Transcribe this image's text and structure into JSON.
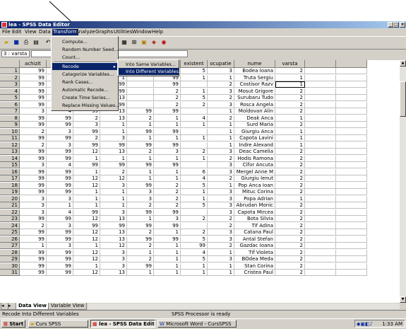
{
  "window": {
    "title": "lea - SPSS Data Editor"
  },
  "menubar": [
    "File",
    "Edit",
    "View",
    "Data",
    "Transform",
    "Analyze",
    "Graphs",
    "Utilities",
    "Window",
    "Help"
  ],
  "menubar_active": "Transform",
  "cellbar": {
    "ref": "3 : varsta"
  },
  "columns": [
    "",
    "achizit",
    "",
    "",
    "",
    "",
    "itate",
    "existent",
    "ocupatie",
    "nume",
    "varsta",
    "",
    ""
  ],
  "rows": [
    [
      "99",
      "",
      "",
      "",
      "",
      "1",
      "5",
      "3",
      "Bodea Ioana",
      "2"
    ],
    [
      "99",
      "",
      "",
      "1",
      "",
      "99",
      "1",
      "1",
      "Truta Sergiu",
      "1"
    ],
    [
      "99",
      "",
      "",
      "99",
      "",
      "99",
      "",
      "2",
      "Costisor Razv",
      "1"
    ],
    [
      "99",
      "",
      "",
      "99",
      "",
      "2",
      "1",
      "3",
      "Mosut Grigore",
      "2"
    ],
    [
      "99",
      "",
      "",
      "13",
      "",
      "2",
      "5",
      "2",
      "Surubaru Tudo",
      "2"
    ],
    [
      "99",
      "",
      "",
      "99",
      "",
      "2",
      "2",
      "3",
      "Rosca Angela",
      "2"
    ],
    [
      "3",
      "4",
      "99",
      "13",
      "99",
      "99",
      "",
      "1",
      "Moldovan Alin",
      "2"
    ],
    [
      "99",
      "99",
      "2",
      "13",
      "2",
      "1",
      "4",
      "2",
      "Deak Anca",
      "1"
    ],
    [
      "99",
      "99",
      "3",
      "1",
      "1",
      "1",
      "1",
      "1",
      "Surd Maria",
      "2"
    ],
    [
      "2",
      "3",
      "99",
      "1",
      "99",
      "99",
      "",
      "1",
      "Giurgiu Anca",
      "1"
    ],
    [
      "99",
      "99",
      "2",
      "3",
      "1",
      "1",
      "1",
      "1",
      "Capota Lavini",
      "1"
    ],
    [
      "2",
      "3",
      "99",
      "99",
      "99",
      "99",
      "",
      "1",
      "Indre Alexand",
      "1"
    ],
    [
      "99",
      "99",
      "12",
      "13",
      "2",
      "3",
      "2",
      "3",
      "Deac Camelia",
      "2"
    ],
    [
      "99",
      "99",
      "1",
      "1",
      "1",
      "1",
      "1",
      "2",
      "Hodis Ramona",
      "2"
    ],
    [
      "3",
      "4",
      "99",
      "99",
      "99",
      "99",
      "",
      "3",
      "Cifor Ancuta",
      "2"
    ],
    [
      "99",
      "99",
      "1",
      "2",
      "1",
      "1",
      "6",
      "3",
      "Mergel Anne M",
      "2"
    ],
    [
      "99",
      "99",
      "12",
      "12",
      "1",
      "1",
      "4",
      "2",
      "Giurgiu Ienut",
      "2"
    ],
    [
      "99",
      "99",
      "12",
      "3",
      "99",
      "2",
      "5",
      "1",
      "Pop Anca Ioan",
      "2"
    ],
    [
      "99",
      "99",
      "1",
      "1",
      "3",
      "2",
      "1",
      "3",
      "Mituc Corina",
      "2"
    ],
    [
      "3",
      "3",
      "1",
      "1",
      "3",
      "2",
      "1",
      "3",
      "Popa Adrian",
      "1"
    ],
    [
      "3",
      "1",
      "1",
      "1",
      "2",
      "2",
      "5",
      "3",
      "Abrudan Monic",
      "2"
    ],
    [
      "3",
      "4",
      "99",
      "3",
      "99",
      "99",
      "",
      "3",
      "Capota Mircea",
      "2"
    ],
    [
      "99",
      "99",
      "12",
      "13",
      "1",
      "3",
      "2",
      "2",
      "Bota Silvia",
      "2"
    ],
    [
      "2",
      "3",
      "99",
      "99",
      "99",
      "99",
      "",
      "2",
      "Tif Adina",
      "2"
    ],
    [
      "99",
      "99",
      "12",
      "13",
      "2",
      "1",
      "2",
      "3",
      "Catana Paul",
      "2"
    ],
    [
      "99",
      "99",
      "12",
      "13",
      "99",
      "99",
      "5",
      "3",
      "Antal Stefan",
      "2"
    ],
    [
      "1",
      "3",
      "1",
      "12",
      "2",
      "1",
      "99",
      "2",
      "Gazdac Ioana",
      "2"
    ],
    [
      "99",
      "99",
      "12",
      "3",
      "1",
      "1",
      "4",
      "1",
      "Tif Violeta",
      "2"
    ],
    [
      "99",
      "99",
      "12",
      "3",
      "2",
      "1",
      "5",
      "3",
      "BOdea Meda",
      "2"
    ],
    [
      "99",
      "99",
      "1",
      "3",
      "99",
      "1",
      "1",
      "1",
      "Stan Corina",
      "2"
    ],
    [
      "99",
      "99",
      "12",
      "13",
      "1",
      "1",
      "1",
      "1",
      "Cristea Paul",
      "2"
    ]
  ],
  "transform_menu": [
    "Compute...",
    "Random Number Seed...",
    "Count...",
    "Recode",
    "Categorize Variables...",
    "Rank Cases...",
    "Automatic Recode...",
    "Create Time Series...",
    "Replace Missing Values..."
  ],
  "recode_submenu": [
    "Into Same Variables...",
    "Into Different Variables..."
  ],
  "tabs": [
    "Data View",
    "Variable View"
  ],
  "status": {
    "left": "Recode Into Different Variables",
    "center": "SPSS Processor  is ready"
  },
  "taskbar": {
    "start": "Start",
    "items": [
      "Curs SPSS",
      "lea - SPSS Data Editor",
      "Microsoft Word - CursSPSS"
    ],
    "clock": "1:33 AM"
  }
}
